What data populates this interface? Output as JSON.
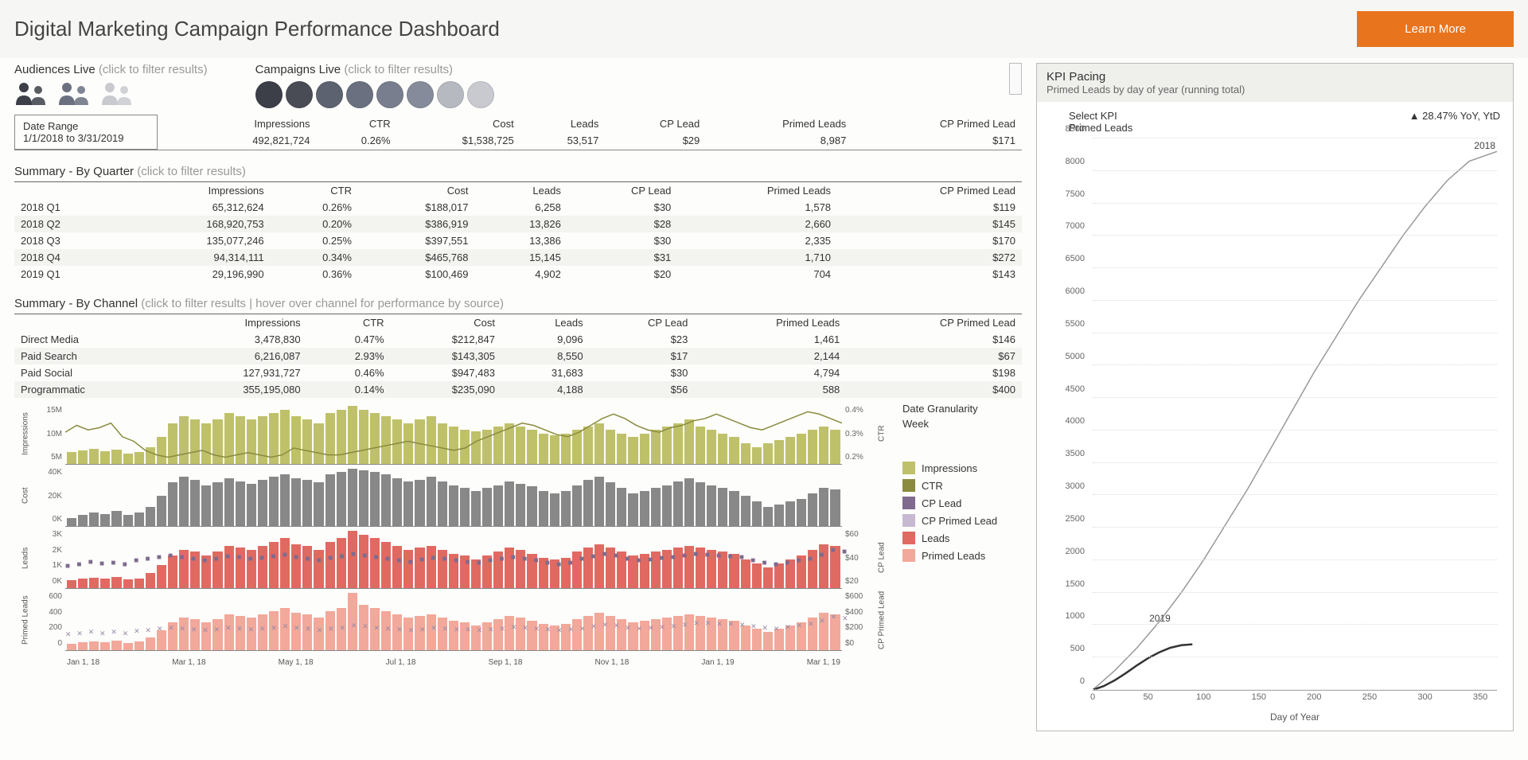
{
  "header": {
    "title": "Digital Marketing Campaign Performance Dashboard",
    "learn_more": "Learn More"
  },
  "filters": {
    "audiences_label": "Audiences Live",
    "audiences_hint": "(click to filter results)",
    "campaigns_label": "Campaigns Live",
    "campaigns_hint": "(click to filter results)",
    "campaign_colors": [
      "#3d3f48",
      "#4a4c55",
      "#5d6270",
      "#6a7080",
      "#787e8e",
      "#858b9a",
      "#b6b9c0",
      "#c8cacf"
    ]
  },
  "date_range": {
    "label": "Date Range",
    "value": "1/1/2018 to 3/31/2019"
  },
  "kpi_totals": {
    "headers": [
      "Impressions",
      "CTR",
      "Cost",
      "Leads",
      "CP Lead",
      "Primed Leads",
      "CP Primed Lead"
    ],
    "values": [
      "492,821,724",
      "0.26%",
      "$1,538,725",
      "53,517",
      "$29",
      "8,987",
      "$171"
    ]
  },
  "quarter": {
    "title": "Summary - By Quarter",
    "hint": "(click to filter results)",
    "headers": [
      "",
      "Impressions",
      "CTR",
      "Cost",
      "Leads",
      "CP Lead",
      "Primed Leads",
      "CP Primed Lead"
    ],
    "rows": [
      [
        "2018 Q1",
        "65,312,624",
        "0.26%",
        "$188,017",
        "6,258",
        "$30",
        "1,578",
        "$119"
      ],
      [
        "2018 Q2",
        "168,920,753",
        "0.20%",
        "$386,919",
        "13,826",
        "$28",
        "2,660",
        "$145"
      ],
      [
        "2018 Q3",
        "135,077,246",
        "0.25%",
        "$397,551",
        "13,386",
        "$30",
        "2,335",
        "$170"
      ],
      [
        "2018 Q4",
        "94,314,111",
        "0.34%",
        "$465,768",
        "15,145",
        "$31",
        "1,710",
        "$272"
      ],
      [
        "2019 Q1",
        "29,196,990",
        "0.36%",
        "$100,469",
        "4,902",
        "$20",
        "704",
        "$143"
      ]
    ]
  },
  "channel": {
    "title": "Summary - By Channel",
    "hint": "(click to filter results | hover over channel for performance by source)",
    "headers": [
      "",
      "Impressions",
      "CTR",
      "Cost",
      "Leads",
      "CP Lead",
      "Primed Leads",
      "CP Primed Lead"
    ],
    "rows": [
      [
        "Direct Media",
        "3,478,830",
        "0.47%",
        "$212,847",
        "9,096",
        "$23",
        "1,461",
        "$146"
      ],
      [
        "Paid Search",
        "6,216,087",
        "2.93%",
        "$143,305",
        "8,550",
        "$17",
        "2,144",
        "$67"
      ],
      [
        "Paid Social",
        "127,931,727",
        "0.46%",
        "$947,483",
        "31,683",
        "$30",
        "4,794",
        "$198"
      ],
      [
        "Programmatic",
        "355,195,080",
        "0.14%",
        "$235,090",
        "4,188",
        "$56",
        "588",
        "$400"
      ]
    ]
  },
  "granularity": {
    "label": "Date Granularity",
    "value": "Week"
  },
  "legend": {
    "items": [
      {
        "name": "Impressions",
        "color": "#bfc16a"
      },
      {
        "name": "CTR",
        "color": "#8a8b3f"
      },
      {
        "name": "CP Lead",
        "color": "#7e6b8e"
      },
      {
        "name": "CP Primed Lead",
        "color": "#c7b9d2"
      },
      {
        "name": "Leads",
        "color": "#e06a62"
      },
      {
        "name": "Primed Leads",
        "color": "#f2a89a"
      }
    ]
  },
  "ts_x_labels": [
    "Jan 1, 18",
    "Mar 1, 18",
    "May 1, 18",
    "Jul 1, 18",
    "Sep 1, 18",
    "Nov 1, 18",
    "Jan 1, 19",
    "Mar 1, 19"
  ],
  "mini_axes": {
    "impressions": {
      "l": [
        "15M",
        "10M",
        "5M"
      ],
      "r": [
        "0.4%",
        "0.3%",
        "0.2%"
      ],
      "llabel": "Impressions",
      "rlabel": "CTR"
    },
    "cost": {
      "l": [
        "40K",
        "20K",
        "0K"
      ],
      "llabel": "Cost"
    },
    "leads": {
      "l": [
        "3K",
        "2K",
        "1K",
        "0K"
      ],
      "r": [
        "$60",
        "$40",
        "$20"
      ],
      "llabel": "Leads",
      "rlabel": "CP Lead"
    },
    "primed": {
      "l": [
        "600",
        "400",
        "200",
        "0"
      ],
      "r": [
        "$600",
        "$400",
        "$200",
        "$0"
      ],
      "llabel": "Primed Leads",
      "rlabel": "CP Primed Lead"
    }
  },
  "pacing": {
    "head_t": "KPI Pacing",
    "head_s": "Primed Leads by day of year (running total)",
    "select_label": "Select KPI",
    "select_value": "Primed Leads",
    "delta": "▲ 28.47% YoY, YtD",
    "x_label": "Day of Year",
    "x_ticks": [
      "0",
      "50",
      "100",
      "150",
      "200",
      "250",
      "300",
      "350"
    ],
    "y_ticks": [
      "0",
      "500",
      "1000",
      "1500",
      "2000",
      "2500",
      "3000",
      "3500",
      "4000",
      "4500",
      "5000",
      "5500",
      "6000",
      "6500",
      "7000",
      "7500",
      "8000",
      "8500"
    ],
    "ann_2018": "2018",
    "ann_2019": "2019"
  },
  "chart_data": {
    "timeseries_weekly": {
      "x_start": "2018-01-01",
      "x_end": "2019-03-31",
      "granularity": "Week",
      "impressions_M": [
        3.5,
        4,
        4.5,
        3.8,
        4.2,
        3,
        3.5,
        5,
        8,
        12,
        14,
        13,
        12,
        13,
        15,
        14,
        13,
        14,
        15,
        16,
        14,
        13,
        12,
        15,
        16,
        17,
        16,
        15,
        14,
        13,
        12,
        13,
        14,
        12,
        11,
        10,
        9.5,
        10,
        11,
        12,
        11,
        10,
        9,
        8.5,
        9,
        10,
        11,
        12,
        10,
        9,
        8,
        9,
        10,
        11,
        12,
        13,
        11,
        10,
        9,
        8,
        6,
        5,
        6,
        7,
        8,
        9,
        10,
        11,
        10
      ],
      "ctr_pct": [
        0.32,
        0.35,
        0.33,
        0.34,
        0.36,
        0.3,
        0.28,
        0.24,
        0.22,
        0.21,
        0.22,
        0.23,
        0.24,
        0.22,
        0.21,
        0.22,
        0.23,
        0.22,
        0.21,
        0.22,
        0.25,
        0.24,
        0.23,
        0.22,
        0.22,
        0.23,
        0.24,
        0.25,
        0.26,
        0.27,
        0.28,
        0.27,
        0.26,
        0.25,
        0.24,
        0.25,
        0.28,
        0.3,
        0.32,
        0.34,
        0.36,
        0.35,
        0.33,
        0.31,
        0.3,
        0.32,
        0.35,
        0.38,
        0.4,
        0.38,
        0.35,
        0.33,
        0.32,
        0.34,
        0.35,
        0.37,
        0.38,
        0.4,
        0.38,
        0.36,
        0.34,
        0.33,
        0.35,
        0.37,
        0.39,
        0.41,
        0.4,
        0.38,
        0.36
      ],
      "cost_K": [
        6,
        8,
        10,
        9,
        11,
        8,
        10,
        14,
        22,
        32,
        36,
        34,
        30,
        32,
        35,
        33,
        31,
        34,
        36,
        38,
        35,
        34,
        32,
        38,
        40,
        42,
        41,
        40,
        38,
        35,
        33,
        34,
        36,
        33,
        30,
        28,
        26,
        28,
        30,
        33,
        31,
        29,
        26,
        24,
        26,
        30,
        34,
        36,
        32,
        28,
        24,
        26,
        28,
        30,
        33,
        35,
        32,
        30,
        28,
        26,
        22,
        18,
        14,
        16,
        18,
        20,
        24,
        28,
        27
      ],
      "leads": [
        400,
        500,
        550,
        480,
        600,
        450,
        520,
        800,
        1200,
        1700,
        2000,
        1900,
        1700,
        1900,
        2200,
        2100,
        2000,
        2200,
        2400,
        2600,
        2300,
        2200,
        2000,
        2400,
        2600,
        3000,
        2800,
        2600,
        2400,
        2200,
        2000,
        2100,
        2200,
        2000,
        1800,
        1700,
        1500,
        1700,
        1900,
        2100,
        2000,
        1800,
        1600,
        1500,
        1600,
        1900,
        2100,
        2300,
        2100,
        1900,
        1700,
        1800,
        1900,
        2000,
        2100,
        2200,
        2100,
        2000,
        1900,
        1800,
        1500,
        1300,
        1100,
        1300,
        1500,
        1700,
        2000,
        2300,
        2200
      ],
      "cp_lead": [
        20,
        22,
        25,
        23,
        24,
        22,
        26,
        28,
        30,
        32,
        30,
        28,
        26,
        28,
        31,
        30,
        28,
        29,
        31,
        33,
        30,
        28,
        26,
        29,
        31,
        34,
        32,
        30,
        28,
        26,
        25,
        27,
        29,
        28,
        26,
        25,
        24,
        26,
        28,
        30,
        28,
        26,
        24,
        22,
        24,
        28,
        31,
        34,
        32,
        28,
        26,
        27,
        29,
        30,
        32,
        34,
        33,
        32,
        31,
        30,
        26,
        24,
        22,
        24,
        26,
        28,
        33,
        38,
        36
      ],
      "primed": [
        80,
        100,
        110,
        95,
        120,
        90,
        105,
        160,
        240,
        340,
        400,
        380,
        340,
        380,
        440,
        420,
        400,
        440,
        480,
        520,
        460,
        440,
        400,
        480,
        520,
        700,
        560,
        520,
        480,
        440,
        400,
        420,
        440,
        400,
        360,
        340,
        300,
        340,
        380,
        420,
        400,
        360,
        320,
        300,
        320,
        380,
        420,
        460,
        420,
        380,
        340,
        360,
        380,
        400,
        420,
        440,
        420,
        400,
        380,
        360,
        300,
        260,
        220,
        260,
        300,
        340,
        400,
        460,
        440
      ],
      "cp_primed": [
        120,
        130,
        140,
        130,
        140,
        125,
        150,
        160,
        180,
        190,
        180,
        170,
        160,
        170,
        190,
        180,
        170,
        175,
        190,
        200,
        185,
        175,
        160,
        180,
        190,
        210,
        200,
        190,
        180,
        170,
        160,
        172,
        185,
        180,
        170,
        165,
        160,
        170,
        180,
        195,
        185,
        175,
        165,
        160,
        165,
        180,
        200,
        220,
        210,
        190,
        180,
        185,
        195,
        205,
        220,
        240,
        235,
        230,
        225,
        220,
        200,
        190,
        180,
        195,
        210,
        230,
        260,
        300,
        290
      ]
    },
    "kpi_pacing": {
      "type": "line",
      "xlabel": "Day of Year",
      "ylabel": "Primed Leads (running total)",
      "ylim": [
        0,
        8500
      ],
      "series": [
        {
          "name": "2018",
          "x": [
            0,
            20,
            40,
            60,
            80,
            100,
            120,
            140,
            160,
            180,
            200,
            220,
            240,
            260,
            280,
            300,
            320,
            340,
            365
          ],
          "y": [
            0,
            300,
            650,
            1050,
            1500,
            2000,
            2550,
            3100,
            3700,
            4300,
            4900,
            5450,
            6000,
            6500,
            7000,
            7450,
            7850,
            8150,
            8300
          ]
        },
        {
          "name": "2019",
          "x": [
            0,
            10,
            20,
            30,
            40,
            50,
            60,
            70,
            80,
            90
          ],
          "y": [
            0,
            60,
            150,
            260,
            380,
            490,
            580,
            650,
            690,
            704
          ]
        }
      ]
    }
  }
}
